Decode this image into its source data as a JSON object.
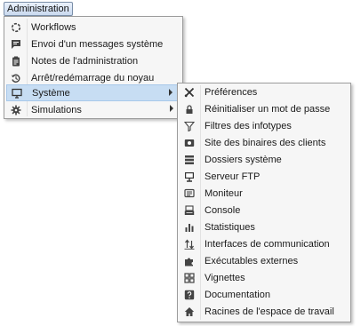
{
  "menubar": {
    "label": "Administration"
  },
  "main_menu": {
    "items": [
      {
        "label": "Workflows",
        "icon": "workflow-icon"
      },
      {
        "label": "Envoi d'un messages système",
        "icon": "message-icon"
      },
      {
        "label": "Notes de l'administration",
        "icon": "notes-icon"
      },
      {
        "label": "Arrêt/redémarrage du noyau",
        "icon": "restart-icon"
      },
      {
        "label": "Système",
        "icon": "monitor-icon",
        "selected": true,
        "submenu": true
      },
      {
        "label": "Simulations",
        "icon": "gear-icon",
        "submenu": true
      }
    ]
  },
  "sub_menu": {
    "items": [
      {
        "label": "Préférences",
        "icon": "tools-icon"
      },
      {
        "label": "Réinitialiser un mot de passe",
        "icon": "lock-icon"
      },
      {
        "label": "Filtres des infotypes",
        "icon": "filter-icon"
      },
      {
        "label": "Site des binaires des clients",
        "icon": "drive-icon"
      },
      {
        "label": "Dossiers système",
        "icon": "server-icon"
      },
      {
        "label": "Serveur FTP",
        "icon": "computer-icon"
      },
      {
        "label": "Moniteur",
        "icon": "monitor-icon"
      },
      {
        "label": "Console",
        "icon": "console-icon"
      },
      {
        "label": "Statistiques",
        "icon": "bar-chart-icon"
      },
      {
        "label": "Interfaces de communication",
        "icon": "transfer-icon"
      },
      {
        "label": "Exécutables externes",
        "icon": "puzzle-icon"
      },
      {
        "label": "Vignettes",
        "icon": "grid-icon"
      },
      {
        "label": "Documentation",
        "icon": "help-icon"
      },
      {
        "label": "Racines de l'espace de travail",
        "icon": "home-icon"
      }
    ]
  },
  "colors": {
    "selection": "#c7ddf3",
    "menu_bg": "#f6f6f6",
    "icon": "#444444"
  }
}
